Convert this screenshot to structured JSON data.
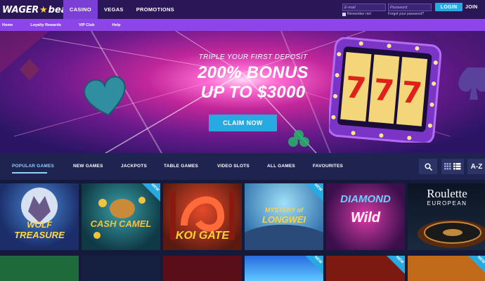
{
  "brand": {
    "logo_part1": "WAGER",
    "logo_part2": "beat"
  },
  "main_nav": [
    {
      "label": "CASINO",
      "active": true
    },
    {
      "label": "VEGAS",
      "active": false
    },
    {
      "label": "PROMOTIONS",
      "active": false
    }
  ],
  "login": {
    "email_placeholder": "E-mail",
    "password_placeholder": "Password",
    "remember_label": "Remember me!",
    "forgot_label": "Forgot your password?",
    "login_button": "LOGIN",
    "join_button": "JOIN"
  },
  "sub_nav": [
    "Home",
    "Loyalty Rewards",
    "VIP Club",
    "Help"
  ],
  "hero": {
    "kicker": "TRIPLE YOUR FIRST DEPOSIT",
    "headline_line1": "200% BONUS",
    "headline_line2": "UP TO $3000",
    "cta": "CLAIM NOW",
    "slot_symbols": [
      "7",
      "7",
      "7"
    ]
  },
  "game_tabs": [
    {
      "label": "POPULAR GAMES",
      "active": true
    },
    {
      "label": "NEW GAMES",
      "active": false
    },
    {
      "label": "JACKPOTS",
      "active": false
    },
    {
      "label": "TABLE GAMES",
      "active": false
    },
    {
      "label": "VIDEO SLOTS",
      "active": false
    },
    {
      "label": "ALL GAMES",
      "active": false
    },
    {
      "label": "FAVOURITES",
      "active": false
    }
  ],
  "tools": {
    "sort_label": "A-Z"
  },
  "games": [
    {
      "line1": "WOLF",
      "line2": "TREASURE",
      "is_new": false
    },
    {
      "line1": "CASH CAMEL",
      "line2": "",
      "is_new": true
    },
    {
      "line1": "KOI GATE",
      "line2": "",
      "is_new": false
    },
    {
      "line1": "MYSTERY of",
      "line2": "LONGWEI",
      "is_new": true
    },
    {
      "line1": "DIAMOND",
      "line2": "Wild",
      "is_new": false
    },
    {
      "line1": "Roulette",
      "line2": "EUROPEAN",
      "is_new": false
    }
  ],
  "new_badge_label": "NEW",
  "colors": {
    "accent": "#27a9e1",
    "purple": "#8c45e6",
    "nav_bg": "#2a1758",
    "page_bg": "#151a3b"
  }
}
